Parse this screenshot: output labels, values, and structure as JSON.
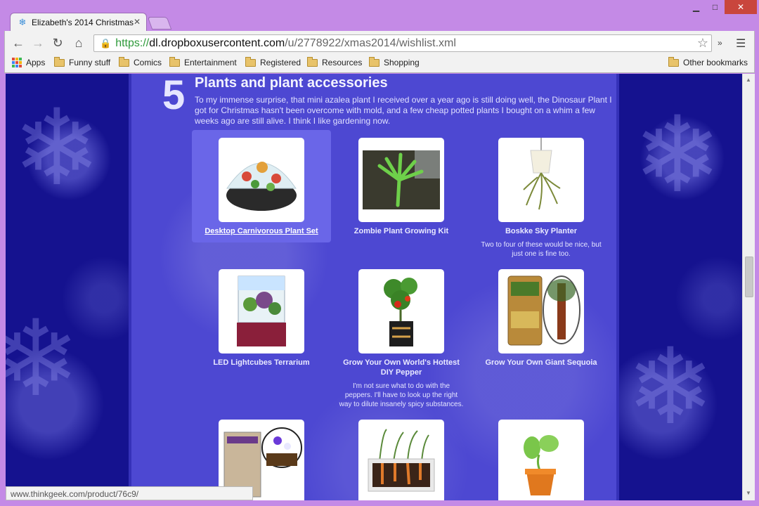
{
  "browser": {
    "tab_title": "Elizabeth's 2014 Christmas",
    "url": {
      "protocol": "https://",
      "host": "dl.dropboxusercontent.com",
      "path": "/u/2778922/xmas2014/wishlist.xml"
    },
    "extensions_more": "»",
    "bookmarks": [
      {
        "label": "Apps",
        "icon": "apps-grid-icon"
      },
      {
        "label": "Funny stuff",
        "icon": "folder-icon"
      },
      {
        "label": "Comics",
        "icon": "folder-icon"
      },
      {
        "label": "Entertainment",
        "icon": "folder-icon"
      },
      {
        "label": "Registered",
        "icon": "folder-icon"
      },
      {
        "label": "Resources",
        "icon": "folder-icon"
      },
      {
        "label": "Shopping",
        "icon": "folder-icon"
      }
    ],
    "other_bookmarks": "Other bookmarks",
    "status_url": "www.thinkgeek.com/product/76c9/"
  },
  "section": {
    "number": "5",
    "title": "Plants and plant accessories",
    "description": "To my immense surprise, that mini azalea plant I received over a year ago is still doing well, the Dinosaur Plant I got for Christmas hasn't been overcome with mold, and a few cheap potted plants I bought on a whim a few weeks ago are still alive. I think I like gardening now."
  },
  "items": [
    {
      "name": "Desktop Carnivorous Plant Set",
      "note": ""
    },
    {
      "name": "Zombie Plant Growing Kit",
      "note": ""
    },
    {
      "name": "Boskke Sky Planter",
      "note": "Two to four of these would be nice, but just one is fine too."
    },
    {
      "name": "LED Lightcubes Terrarium",
      "note": ""
    },
    {
      "name": "Grow Your Own World's Hottest DIY Pepper",
      "note": "I'm not sure what to do with the peppers. I'll have to look up the right way to dilute insanely spicy substances."
    },
    {
      "name": "Grow Your Own Giant Sequoia",
      "note": ""
    }
  ],
  "colors": {
    "page_bg": "#12108a",
    "content_bg": "#4d48d2",
    "highlight": "#6a66e8",
    "window_frame": "#c48ae6"
  }
}
